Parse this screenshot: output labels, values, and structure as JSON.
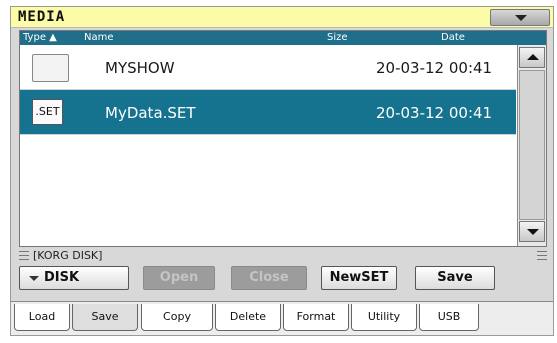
{
  "header": {
    "title": "MEDIA"
  },
  "columns": {
    "type": "Type ▲",
    "name": "Name",
    "size": "Size",
    "date": "Date"
  },
  "rows": [
    {
      "icon": "folder-icon",
      "name": "MYSHOW",
      "date": "20-03-12 00:41",
      "selected": false
    },
    {
      "icon": "set-file-icon",
      "icon_text": ".SET",
      "name": "MyData.SET",
      "date": "20-03-12 00:41",
      "selected": true
    }
  ],
  "path": "[KORG DISK]",
  "buttons": {
    "disk": "DISK",
    "open": "Open",
    "close": "Close",
    "newset": "NewSET",
    "save": "Save"
  },
  "tabs": {
    "load": "Load",
    "save": "Save",
    "copy": "Copy",
    "delete": "Delete",
    "format": "Format",
    "utility": "Utility",
    "usb": "USB"
  },
  "colors": {
    "header_bg": "#fbfba8",
    "selection": "#16738f",
    "column_header": "#1f6f8a"
  }
}
